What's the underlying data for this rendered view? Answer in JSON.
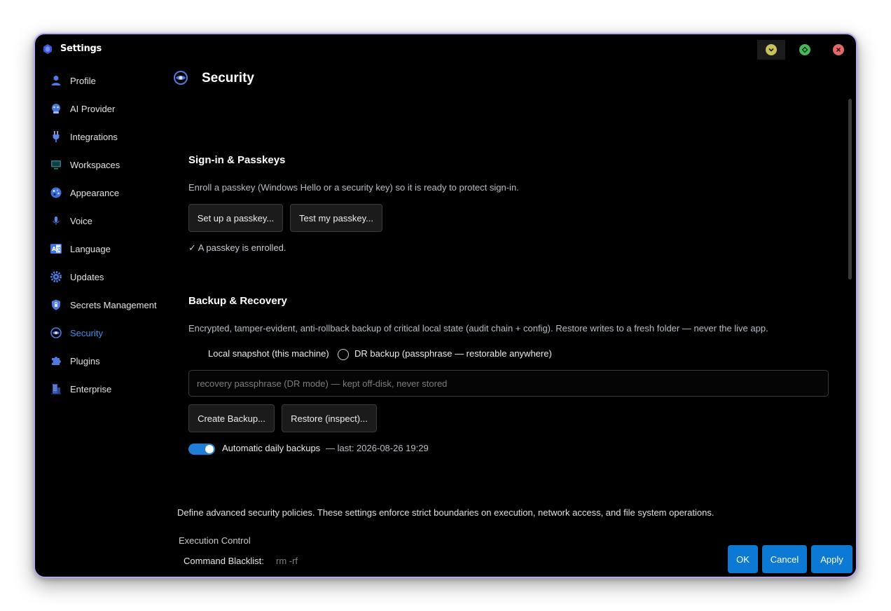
{
  "window": {
    "title": "Settings"
  },
  "colors": {
    "accent": "#0c7ad4",
    "active_nav": "#3d8ee6",
    "border": "#b7a6f0"
  },
  "sidebar": {
    "items": [
      {
        "label": "Profile",
        "icon": "user-icon"
      },
      {
        "label": "AI Provider",
        "icon": "ai-provider-icon"
      },
      {
        "label": "Integrations",
        "icon": "plug-icon"
      },
      {
        "label": "Workspaces",
        "icon": "monitor-icon"
      },
      {
        "label": "Appearance",
        "icon": "palette-icon"
      },
      {
        "label": "Voice",
        "icon": "microphone-icon"
      },
      {
        "label": "Language",
        "icon": "translate-icon"
      },
      {
        "label": "Updates",
        "icon": "gear-icon"
      },
      {
        "label": "Secrets Management",
        "icon": "shield-lock-icon"
      },
      {
        "label": "Security",
        "icon": "security-icon",
        "active": true
      },
      {
        "label": "Plugins",
        "icon": "puzzle-icon"
      },
      {
        "label": "Enterprise",
        "icon": "building-icon"
      }
    ]
  },
  "page": {
    "title": "Security"
  },
  "signin": {
    "title": "Sign-in & Passkeys",
    "description": "Enroll a passkey (Windows Hello or a security key) so it is ready to protect sign-in.",
    "setup_button": "Set up a passkey...",
    "test_button": "Test my passkey...",
    "status": "✓ A passkey is enrolled."
  },
  "backup": {
    "title": "Backup & Recovery",
    "description": "Encrypted, tamper-evident, anti-rollback backup of critical local state (audit chain + config). Restore writes to a fresh folder — never the live app.",
    "option_local": "Local snapshot (this machine)",
    "option_dr": "DR backup (passphrase — restorable anywhere)",
    "passphrase_placeholder": "recovery passphrase (DR mode) — kept off-disk, never stored",
    "create_button": "Create Backup...",
    "restore_button": "Restore (inspect)...",
    "auto_label": "Automatic daily backups",
    "auto_enabled": true,
    "last_label": "— last: 2026-08-26 19:29"
  },
  "policies": {
    "description": "Define advanced security policies. These settings enforce strict boundaries on execution, network access, and file system operations.",
    "execution_title": "Execution Control",
    "blacklist_label": "Command Blacklist:",
    "blacklist_value": "rm -rf"
  },
  "footer": {
    "ok": "OK",
    "cancel": "Cancel",
    "apply": "Apply"
  }
}
